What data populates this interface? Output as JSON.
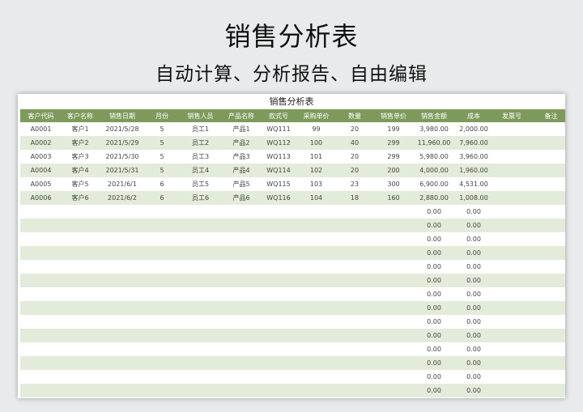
{
  "page": {
    "headline": "销售分析表",
    "subline": "自动计算、分析报告、自由编辑"
  },
  "sheet": {
    "title": "销售分析表",
    "columns": [
      "客户代码",
      "客户名称",
      "销售日期",
      "月份",
      "销售人员",
      "产品名称",
      "款式号",
      "采购单价",
      "数量",
      "销售单价",
      "销售金额",
      "成本",
      "发票号",
      "备注"
    ],
    "rows": [
      [
        "A0001",
        "客户1",
        "2021/5/28",
        "5",
        "员工1",
        "产品1",
        "WQ111",
        "99",
        "20",
        "199",
        "3,980.00",
        "2,000.00",
        "",
        ""
      ],
      [
        "A0002",
        "客户2",
        "2021/5/29",
        "5",
        "员工2",
        "产品2",
        "WQ112",
        "100",
        "40",
        "299",
        "11,960.00",
        "7,960.00",
        "",
        ""
      ],
      [
        "A0003",
        "客户3",
        "2021/5/30",
        "5",
        "员工3",
        "产品3",
        "WQ113",
        "101",
        "20",
        "299",
        "5,980.00",
        "3,960.00",
        "",
        ""
      ],
      [
        "A0004",
        "客户4",
        "2021/5/31",
        "5",
        "员工4",
        "产品4",
        "WQ114",
        "102",
        "20",
        "200",
        "4,000.00",
        "1,960.00",
        "",
        ""
      ],
      [
        "A0005",
        "客户5",
        "2021/6/1",
        "6",
        "员工5",
        "产品5",
        "WQ115",
        "103",
        "23",
        "300",
        "6,900.00",
        "4,531.00",
        "",
        ""
      ],
      [
        "A0006",
        "客户6",
        "2021/6/2",
        "6",
        "员工6",
        "产品6",
        "WQ116",
        "104",
        "18",
        "160",
        "2,880.00",
        "1,008.00",
        "",
        ""
      ],
      [
        "",
        "",
        "",
        "",
        "",
        "",
        "",
        "",
        "",
        "",
        "0.00",
        "0.00",
        "",
        ""
      ],
      [
        "",
        "",
        "",
        "",
        "",
        "",
        "",
        "",
        "",
        "",
        "0.00",
        "0.00",
        "",
        ""
      ],
      [
        "",
        "",
        "",
        "",
        "",
        "",
        "",
        "",
        "",
        "",
        "0.00",
        "0.00",
        "",
        ""
      ],
      [
        "",
        "",
        "",
        "",
        "",
        "",
        "",
        "",
        "",
        "",
        "0.00",
        "0.00",
        "",
        ""
      ],
      [
        "",
        "",
        "",
        "",
        "",
        "",
        "",
        "",
        "",
        "",
        "0.00",
        "0.00",
        "",
        ""
      ],
      [
        "",
        "",
        "",
        "",
        "",
        "",
        "",
        "",
        "",
        "",
        "0.00",
        "0.00",
        "",
        ""
      ],
      [
        "",
        "",
        "",
        "",
        "",
        "",
        "",
        "",
        "",
        "",
        "0.00",
        "0.00",
        "",
        ""
      ],
      [
        "",
        "",
        "",
        "",
        "",
        "",
        "",
        "",
        "",
        "",
        "0.00",
        "0.00",
        "",
        ""
      ],
      [
        "",
        "",
        "",
        "",
        "",
        "",
        "",
        "",
        "",
        "",
        "0.00",
        "0.00",
        "",
        ""
      ],
      [
        "",
        "",
        "",
        "",
        "",
        "",
        "",
        "",
        "",
        "",
        "0.00",
        "0.00",
        "",
        ""
      ],
      [
        "",
        "",
        "",
        "",
        "",
        "",
        "",
        "",
        "",
        "",
        "0.00",
        "0.00",
        "",
        ""
      ],
      [
        "",
        "",
        "",
        "",
        "",
        "",
        "",
        "",
        "",
        "",
        "0.00",
        "0.00",
        "",
        ""
      ],
      [
        "",
        "",
        "",
        "",
        "",
        "",
        "",
        "",
        "",
        "",
        "0.00",
        "0.00",
        "",
        ""
      ],
      [
        "",
        "",
        "",
        "",
        "",
        "",
        "",
        "",
        "",
        "",
        "0.00",
        "0.00",
        "",
        ""
      ]
    ],
    "colors": {
      "header_bg": "#7d9a5c",
      "stripe_bg": "#e3ecdb"
    }
  }
}
